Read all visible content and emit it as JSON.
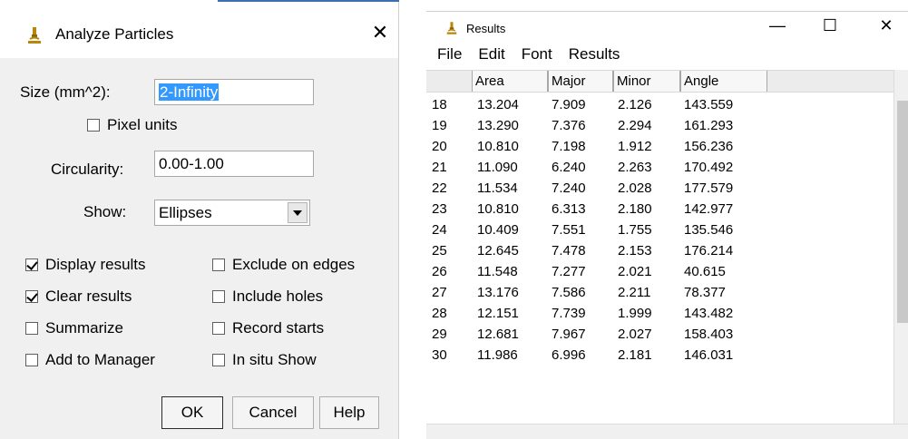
{
  "dialog": {
    "title": "Analyze Particles",
    "size_label": "Size (mm^2):",
    "size_value": "2-Infinity",
    "pixel_units_label": "Pixel units",
    "circularity_label": "Circularity:",
    "circularity_value": "0.00-1.00",
    "show_label": "Show:",
    "show_value": "Ellipses",
    "options": {
      "display_results": "Display results",
      "exclude_on_edges": "Exclude on edges",
      "clear_results": "Clear results",
      "include_holes": "Include holes",
      "summarize": "Summarize",
      "record_starts": "Record starts",
      "add_to_manager": "Add to Manager",
      "in_situ_show": "In situ Show"
    },
    "buttons": {
      "ok": "OK",
      "cancel": "Cancel",
      "help": "Help"
    },
    "close_glyph": "✕"
  },
  "results": {
    "title": "Results",
    "controls": {
      "minimize": "—",
      "maximize": "☐",
      "close": "✕"
    },
    "menu": [
      "File",
      "Edit",
      "Font",
      "Results"
    ],
    "columns": [
      "Area",
      "Major",
      "Minor",
      "Angle"
    ],
    "rows": [
      {
        "n": "18",
        "area": "13.204",
        "major": "7.909",
        "minor": "2.126",
        "angle": "143.559"
      },
      {
        "n": "19",
        "area": "13.290",
        "major": "7.376",
        "minor": "2.294",
        "angle": "161.293"
      },
      {
        "n": "20",
        "area": "10.810",
        "major": "7.198",
        "minor": "1.912",
        "angle": "156.236"
      },
      {
        "n": "21",
        "area": "11.090",
        "major": "6.240",
        "minor": "2.263",
        "angle": "170.492"
      },
      {
        "n": "22",
        "area": "11.534",
        "major": "7.240",
        "minor": "2.028",
        "angle": "177.579"
      },
      {
        "n": "23",
        "area": "10.810",
        "major": "6.313",
        "minor": "2.180",
        "angle": "142.977"
      },
      {
        "n": "24",
        "area": "10.409",
        "major": "7.551",
        "minor": "1.755",
        "angle": "135.546"
      },
      {
        "n": "25",
        "area": "12.645",
        "major": "7.478",
        "minor": "2.153",
        "angle": "176.214"
      },
      {
        "n": "26",
        "area": "11.548",
        "major": "7.277",
        "minor": "2.021",
        "angle": "40.615"
      },
      {
        "n": "27",
        "area": "13.176",
        "major": "7.586",
        "minor": "2.211",
        "angle": "78.377"
      },
      {
        "n": "28",
        "area": "12.151",
        "major": "7.739",
        "minor": "1.999",
        "angle": "143.482"
      },
      {
        "n": "29",
        "area": "12.681",
        "major": "7.967",
        "minor": "2.027",
        "angle": "158.403"
      },
      {
        "n": "30",
        "area": "11.986",
        "major": "6.996",
        "minor": "2.181",
        "angle": "146.031"
      }
    ]
  },
  "checkbox_states": {
    "pixel_units": false,
    "display_results": true,
    "exclude_on_edges": false,
    "clear_results": true,
    "include_holes": false,
    "summarize": false,
    "record_starts": false,
    "add_to_manager": false,
    "in_situ_show": false
  },
  "colors": {
    "selection": "#3399ff",
    "dialog_bg": "#f0f0f0",
    "header_bg": "#ececec"
  },
  "icons": {
    "app": "microscope-icon",
    "dropdown": "chevron-down-icon",
    "close": "close-icon"
  }
}
